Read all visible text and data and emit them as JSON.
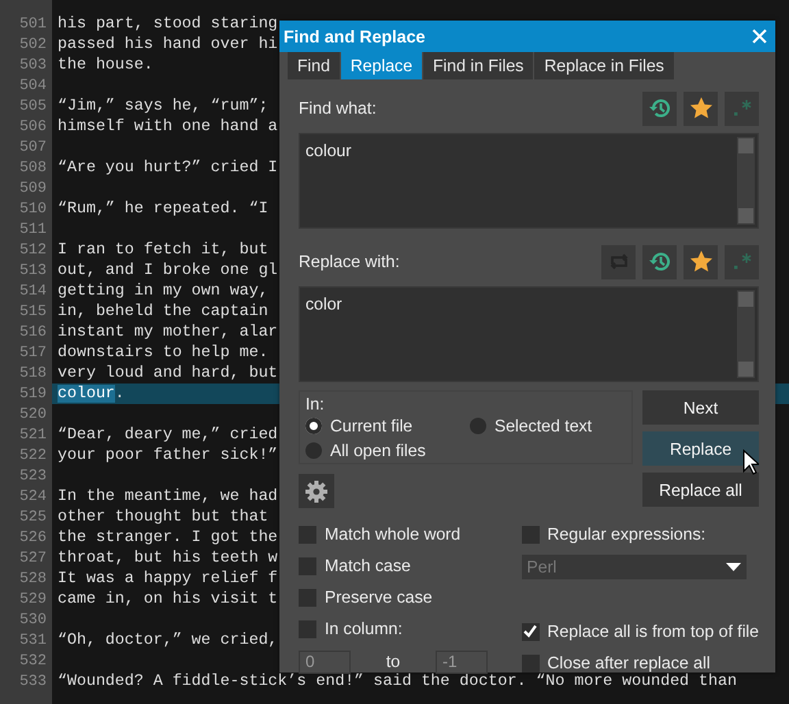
{
  "editor": {
    "lines": [
      {
        "number": "501",
        "text": "his part, stood staring",
        "current": false
      },
      {
        "number": "502",
        "text": "passed his hand over hi",
        "current": false
      },
      {
        "number": "503",
        "text": "the house.",
        "current": false
      },
      {
        "number": "504",
        "current": false
      },
      {
        "number": "505",
        "text": "“Jim,” says he, “rum”;",
        "current": false
      },
      {
        "number": "506",
        "text": "himself with one hand a",
        "current": false
      },
      {
        "number": "507",
        "current": false
      },
      {
        "number": "508",
        "text": "“Are you hurt?” cried I",
        "current": false
      },
      {
        "number": "509",
        "current": false
      },
      {
        "number": "510",
        "text": "“Rum,” he repeated. “I",
        "current": false
      },
      {
        "number": "511",
        "current": false
      },
      {
        "number": "512",
        "text": "I ran to fetch it, but",
        "current": false
      },
      {
        "number": "513",
        "text": "out, and I broke one gl",
        "current": false
      },
      {
        "number": "514",
        "text": "getting in my own way,",
        "current": false
      },
      {
        "number": "515",
        "text": "in, beheld the captain",
        "current": false
      },
      {
        "number": "516",
        "text": "instant my mother, alar",
        "current": false
      },
      {
        "number": "517",
        "text": "downstairs to help me.",
        "current": false
      },
      {
        "number": "518",
        "text": "very loud and hard, but",
        "current": false
      },
      {
        "number": "519",
        "selection": "colour",
        "text": ".",
        "current": true
      },
      {
        "number": "520",
        "current": false
      },
      {
        "number": "521",
        "text": "“Dear, deary me,” cried",
        "current": false
      },
      {
        "number": "522",
        "text": "your poor father sick!”",
        "current": false
      },
      {
        "number": "523",
        "current": false
      },
      {
        "number": "524",
        "text": "In the meantime, we had",
        "current": false
      },
      {
        "number": "525",
        "text": "other thought but that",
        "current": false
      },
      {
        "number": "526",
        "text": "the stranger. I got the",
        "current": false
      },
      {
        "number": "527",
        "text": "throat, but his teeth w",
        "current": false
      },
      {
        "number": "528",
        "text": "It was a happy relief f",
        "current": false
      },
      {
        "number": "529",
        "text": "came in, on his visit t",
        "current": false
      },
      {
        "number": "530",
        "current": false
      },
      {
        "number": "531",
        "text": "“Oh, doctor,” we cried,",
        "current": false
      },
      {
        "number": "532",
        "current": false
      },
      {
        "number": "533",
        "text": "“Wounded? A fiddle-stick’s end!” said the doctor. “No more wounded than",
        "current": false
      }
    ]
  },
  "dialog": {
    "title": "Find and Replace",
    "tabs": [
      {
        "label": "Find",
        "selected": false
      },
      {
        "label": "Replace",
        "selected": true
      },
      {
        "label": "Find in Files",
        "selected": false
      },
      {
        "label": "Replace in Files",
        "selected": false
      }
    ],
    "find": {
      "label": "Find what:",
      "value": "colour"
    },
    "replace": {
      "label": "Replace with:",
      "value": "color"
    },
    "scope": {
      "label": "In:",
      "options": [
        {
          "label": "Current file",
          "selected": true
        },
        {
          "label": "Selected text",
          "selected": false
        },
        {
          "label": "All open files",
          "selected": false
        }
      ]
    },
    "buttons": [
      {
        "label": "Next",
        "hovered": false
      },
      {
        "label": "Replace",
        "hovered": true
      },
      {
        "label": "Replace all",
        "hovered": false
      }
    ],
    "left_options": [
      {
        "label": "Match whole word",
        "checked": false
      },
      {
        "label": "Match case",
        "checked": false
      },
      {
        "label": "Preserve case",
        "checked": false
      },
      {
        "label": "In column:",
        "checked": false
      }
    ],
    "column": {
      "from": "0",
      "to_label": "to",
      "to": "-1"
    },
    "regex": {
      "label": "Regular expressions:",
      "checked": false,
      "syntax": "Perl"
    },
    "right_options": [
      {
        "label": "Replace all is from top of file",
        "checked": true
      },
      {
        "label": "Close after replace all",
        "checked": false
      }
    ]
  }
}
